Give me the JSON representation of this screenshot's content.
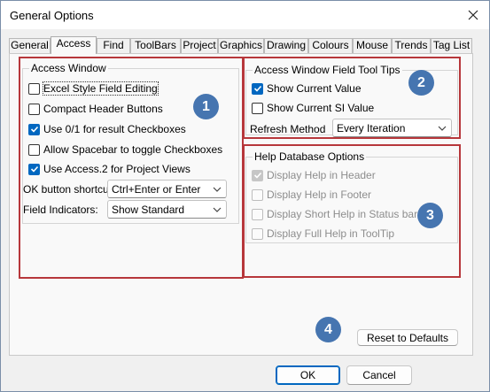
{
  "window": {
    "title": "General Options"
  },
  "tabs": [
    {
      "label": "General"
    },
    {
      "label": "Access",
      "active": true
    },
    {
      "label": "Find"
    },
    {
      "label": "ToolBars"
    },
    {
      "label": "Project"
    },
    {
      "label": "Graphics"
    },
    {
      "label": "Drawing"
    },
    {
      "label": "Colours"
    },
    {
      "label": "Mouse"
    },
    {
      "label": "Trends"
    },
    {
      "label": "Tag List"
    }
  ],
  "access_window": {
    "title": "Access Window",
    "options": [
      {
        "label": "Excel Style Field Editing",
        "checked": false
      },
      {
        "label": "Compact Header Buttons",
        "checked": false
      },
      {
        "label": "Use 0/1 for result Checkboxes",
        "checked": true
      },
      {
        "label": "Allow Spacebar to toggle Checkboxes",
        "checked": false
      },
      {
        "label": "Use Access.2 for Project Views",
        "checked": true
      }
    ],
    "ok_shortcut": {
      "label": "OK button shortcut:",
      "value": "Ctrl+Enter or Enter"
    },
    "field_indicators": {
      "label": "Field Indicators:",
      "value": "Show Standard"
    }
  },
  "field_tool_tips": {
    "title": "Access Window Field Tool Tips",
    "options": [
      {
        "label": "Show Current Value",
        "checked": true
      },
      {
        "label": "Show Current SI Value",
        "checked": false
      }
    ],
    "refresh": {
      "label": "Refresh Method",
      "value": "Every Iteration"
    }
  },
  "help_database": {
    "title": "Help Database Options",
    "options": [
      {
        "label": "Display Help in Header",
        "checked": true
      },
      {
        "label": "Display Help in Footer",
        "checked": false
      },
      {
        "label": "Display Short Help in Status bar",
        "checked": false
      },
      {
        "label": "Display Full Help in ToolTip",
        "checked": false
      }
    ]
  },
  "buttons": {
    "reset": "Reset to Defaults",
    "ok": "OK",
    "cancel": "Cancel"
  },
  "callouts": [
    "1",
    "2",
    "3",
    "4"
  ],
  "colors": {
    "highlight": "#b7373b",
    "badge": "#4675b0",
    "accent": "#0067c0"
  },
  "icons": {
    "close": "close-icon",
    "dropdown": "chevron-down-icon",
    "check": "checkmark-icon"
  }
}
